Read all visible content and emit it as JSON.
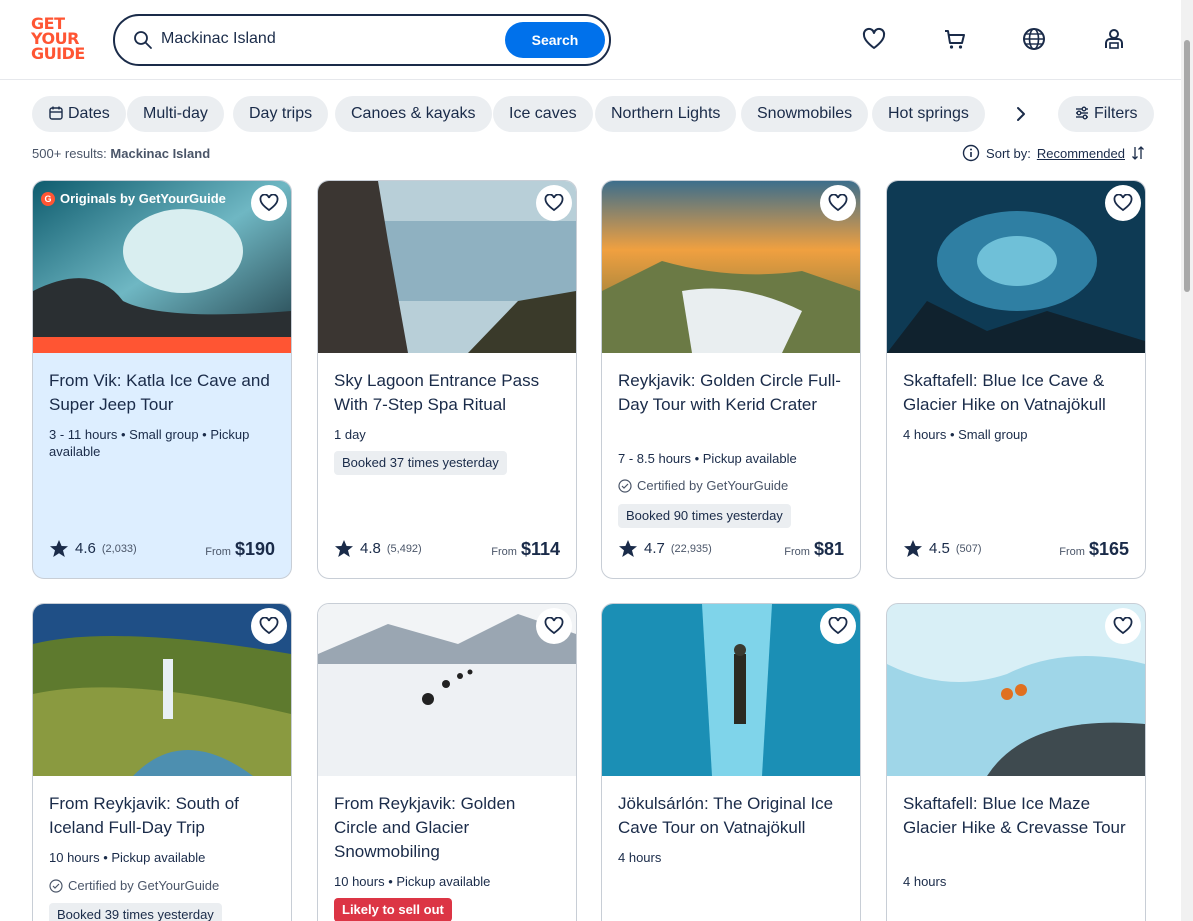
{
  "brand": {
    "logo_lines": [
      "GET",
      "YOUR",
      "GUIDE"
    ],
    "color": "#ff5533"
  },
  "search": {
    "value": "Mackinac Island",
    "button_label": "Search"
  },
  "header_icons": [
    "heart-icon",
    "cart-icon",
    "globe-icon",
    "profile-icon"
  ],
  "chips": [
    "Dates",
    "Multi-day",
    "Day trips",
    "Canoes & kayaks",
    "Ice caves",
    "Northern Lights",
    "Snowmobiles",
    "Hot springs"
  ],
  "filters_label": "Filters",
  "results": {
    "prefix": "500+ results:",
    "query": "Mackinac Island"
  },
  "sort": {
    "label": "Sort by:",
    "value": "Recommended"
  },
  "cards": [
    {
      "title": "From Vik: Katla Ice Cave and Super Jeep Tour",
      "meta": "3 - 11 hours • Small group • Pickup available",
      "rating": "4.6",
      "reviews": "(2,033)",
      "price_prefix": "From",
      "price": "$190",
      "originals": "Originals by GetYourGuide"
    },
    {
      "title": "Sky Lagoon Entrance Pass With 7-Step Spa Ritual",
      "meta": "1 day",
      "badge": "Booked 37 times yesterday",
      "rating": "4.8",
      "reviews": "(5,492)",
      "price_prefix": "From",
      "price": "$114"
    },
    {
      "title": "Reykjavik: Golden Circle Full-Day Tour with Kerid Crater",
      "meta": "7 - 8.5 hours • Pickup available",
      "cert": "Certified by GetYourGuide",
      "badge": "Booked 90 times yesterday",
      "rating": "4.7",
      "reviews": "(22,935)",
      "price_prefix": "From",
      "price": "$81"
    },
    {
      "title": "Skaftafell: Blue Ice Cave & Glacier Hike on Vatnajökull",
      "meta": "4 hours • Small group",
      "rating": "4.5",
      "reviews": "(507)",
      "price_prefix": "From",
      "price": "$165"
    },
    {
      "title": "From Reykjavik: South of Iceland Full-Day Trip",
      "meta": "10 hours • Pickup available",
      "cert": "Certified by GetYourGuide",
      "badge": "Booked 39 times yesterday"
    },
    {
      "title": "From Reykjavik: Golden Circle and Glacier Snowmobiling",
      "meta": "10 hours • Pickup available",
      "badge": "Likely to sell out"
    },
    {
      "title": "Jökulsárlón: The Original Ice Cave Tour on Vatnajökull",
      "meta": "4 hours"
    },
    {
      "title": "Skaftafell: Blue Ice Maze Glacier Hike & Crevasse Tour",
      "meta": "4 hours"
    }
  ]
}
